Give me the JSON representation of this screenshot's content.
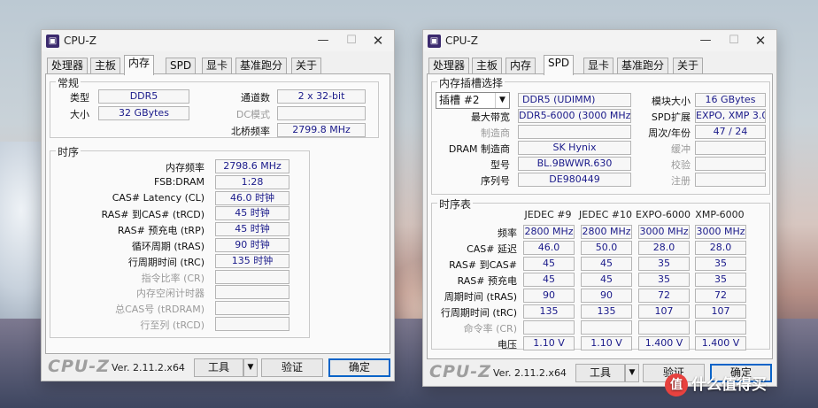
{
  "left": {
    "title": "CPU-Z",
    "tabs": [
      "处理器",
      "主板",
      "内存",
      "SPD",
      "显卡",
      "基准跑分",
      "关于"
    ],
    "general": {
      "title": "常规",
      "type_label": "类型",
      "type_value": "DDR5",
      "size_label": "大小",
      "size_value": "32 GBytes",
      "channels_label": "通道数",
      "channels_value": "2 x 32-bit",
      "dc_label": "DC模式",
      "dc_value": "",
      "nb_label": "北桥频率",
      "nb_value": "2799.8 MHz"
    },
    "timings": {
      "title": "时序",
      "rows": [
        {
          "label": "内存频率",
          "value": "2798.6 MHz"
        },
        {
          "label": "FSB:DRAM",
          "value": "1:28"
        },
        {
          "label": "CAS# Latency (CL)",
          "value": "46.0 时钟"
        },
        {
          "label": "RAS# 到CAS# (tRCD)",
          "value": "45 时钟"
        },
        {
          "label": "RAS# 预充电 (tRP)",
          "value": "45 时钟"
        },
        {
          "label": "循环周期 (tRAS)",
          "value": "90 时钟"
        },
        {
          "label": "行周期时间 (tRC)",
          "value": "135 时钟"
        },
        {
          "label": "指令比率 (CR)",
          "value": ""
        },
        {
          "label": "内存空闲计时器",
          "value": ""
        },
        {
          "label": "总CAS号 (tRDRAM)",
          "value": ""
        },
        {
          "label": "行至列 (tRCD)",
          "value": ""
        }
      ]
    },
    "footer": {
      "brand": "CPU-Z",
      "version": "Ver. 2.11.2.x64",
      "tools": "工具",
      "validate": "验证",
      "ok": "确定"
    }
  },
  "right": {
    "title": "CPU-Z",
    "tabs": [
      "处理器",
      "主板",
      "内存",
      "SPD",
      "显卡",
      "基准跑分",
      "关于"
    ],
    "slot": {
      "title": "内存插槽选择",
      "slot_value": "插槽 #2",
      "type_value": "DDR5 (UDIMM)",
      "module_size_label": "模块大小",
      "module_size_value": "16 GBytes",
      "max_bw_label": "最大带宽",
      "max_bw_value": "DDR5-6000 (3000 MHz)",
      "spd_ext_label": "SPD扩展",
      "spd_ext_value": "EXPO, XMP 3.0",
      "mfr_label": "制造商",
      "mfr_value": "",
      "week_year_label": "周次/年份",
      "week_year_value": "47 / 24",
      "dram_mfr_label": "DRAM 制造商",
      "dram_mfr_value": "SK Hynix",
      "buffer_label": "缓冲",
      "buffer_value": "",
      "part_label": "型号",
      "part_value": "BL.9BWWR.630",
      "check_label": "校验",
      "check_value": "",
      "serial_label": "序列号",
      "serial_value": "DE980449",
      "reg_label": "注册",
      "reg_value": ""
    },
    "timing_table": {
      "title": "时序表",
      "columns": [
        "JEDEC #9",
        "JEDEC #10",
        "EXPO-6000",
        "XMP-6000"
      ],
      "rows": [
        {
          "label": "频率",
          "values": [
            "2800 MHz",
            "2800 MHz",
            "3000 MHz",
            "3000 MHz"
          ],
          "dim": false
        },
        {
          "label": "CAS# 延迟",
          "values": [
            "46.0",
            "50.0",
            "28.0",
            "28.0"
          ],
          "dim": false
        },
        {
          "label": "RAS# 到CAS#",
          "values": [
            "45",
            "45",
            "35",
            "35"
          ],
          "dim": false
        },
        {
          "label": "RAS# 预充电",
          "values": [
            "45",
            "45",
            "35",
            "35"
          ],
          "dim": false
        },
        {
          "label": "周期时间 (tRAS)",
          "values": [
            "90",
            "90",
            "72",
            "72"
          ],
          "dim": false
        },
        {
          "label": "行周期时间 (tRC)",
          "values": [
            "135",
            "135",
            "107",
            "107"
          ],
          "dim": false
        },
        {
          "label": "命令率 (CR)",
          "values": [
            "",
            "",
            "",
            ""
          ],
          "dim": true
        },
        {
          "label": "电压",
          "values": [
            "1.10 V",
            "1.10 V",
            "1.400 V",
            "1.400 V"
          ],
          "dim": false
        }
      ]
    },
    "footer": {
      "brand": "CPU-Z",
      "version": "Ver. 2.11.2.x64",
      "tools": "工具",
      "validate": "验证",
      "ok": "确定"
    }
  },
  "watermark": {
    "logo": "值",
    "text": "什么值得买"
  }
}
